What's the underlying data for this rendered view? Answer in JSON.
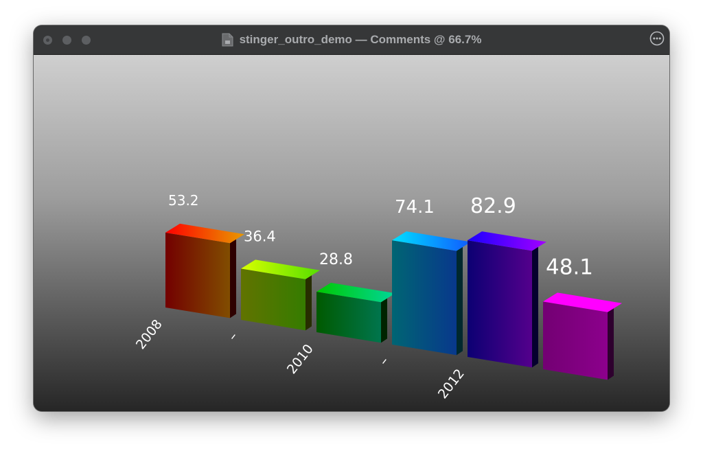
{
  "window": {
    "title": "stinger_outro_demo — Comments @ 66.7%"
  },
  "chart_data": {
    "type": "bar",
    "categories": [
      "2008",
      "–",
      "2010",
      "–",
      "2012",
      ""
    ],
    "values": [
      53.2,
      36.4,
      28.8,
      74.1,
      82.9,
      48.1
    ],
    "value_labels": [
      "53.2",
      "36.4",
      "28.8",
      "74.1",
      "82.9",
      "48.1"
    ],
    "colors": [
      "#ff0000",
      "#d8ff00",
      "#00c800",
      "#00e0ff",
      "#1a00ff",
      "#ff00ff"
    ],
    "title": "",
    "xlabel": "",
    "ylabel": "",
    "grid": false,
    "legend": "none"
  }
}
